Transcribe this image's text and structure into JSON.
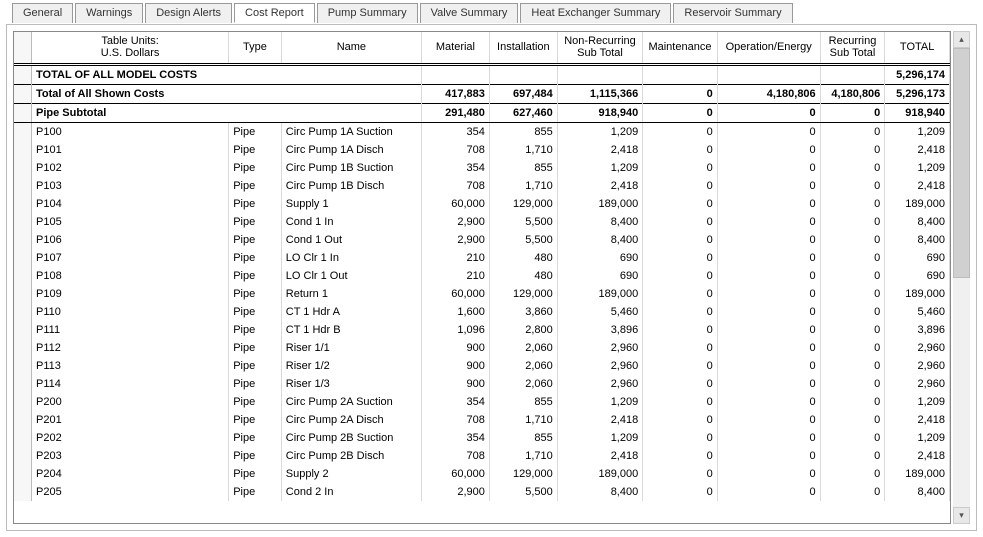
{
  "tabs": [
    {
      "label": "General"
    },
    {
      "label": "Warnings"
    },
    {
      "label": "Design Alerts"
    },
    {
      "label": "Cost Report",
      "active": true
    },
    {
      "label": "Pump Summary"
    },
    {
      "label": "Valve Summary"
    },
    {
      "label": "Heat Exchanger Summary"
    },
    {
      "label": "Reservoir Summary"
    }
  ],
  "headers": {
    "units": "Table Units:\nU.S. Dollars",
    "type": "Type",
    "name": "Name",
    "material": "Material",
    "installation": "Installation",
    "nr_subtotal": "Non-Recurring\nSub Total",
    "maintenance": "Maintenance",
    "op_energy": "Operation/Energy",
    "r_subtotal": "Recurring\nSub Total",
    "total": "TOTAL"
  },
  "summary": {
    "model_total": {
      "label": "TOTAL OF ALL MODEL COSTS",
      "total": "5,296,174"
    },
    "shown_total": {
      "label": "Total of All Shown Costs",
      "material": "417,883",
      "installation": "697,484",
      "nrst": "1,115,366",
      "maint": "0",
      "open": "4,180,806",
      "rst": "4,180,806",
      "total": "5,296,173"
    },
    "pipe_subtotal": {
      "label": "Pipe Subtotal",
      "material": "291,480",
      "installation": "627,460",
      "nrst": "918,940",
      "maint": "0",
      "open": "0",
      "rst": "0",
      "total": "918,940"
    }
  },
  "rows": [
    {
      "id": "P100",
      "type": "Pipe",
      "name": "Circ Pump 1A Suction",
      "m": "354",
      "i": "855",
      "nr": "1,209",
      "mt": "0",
      "oe": "0",
      "rs": "0",
      "t": "1,209"
    },
    {
      "id": "P101",
      "type": "Pipe",
      "name": "Circ Pump 1A Disch",
      "m": "708",
      "i": "1,710",
      "nr": "2,418",
      "mt": "0",
      "oe": "0",
      "rs": "0",
      "t": "2,418"
    },
    {
      "id": "P102",
      "type": "Pipe",
      "name": "Circ Pump 1B Suction",
      "m": "354",
      "i": "855",
      "nr": "1,209",
      "mt": "0",
      "oe": "0",
      "rs": "0",
      "t": "1,209"
    },
    {
      "id": "P103",
      "type": "Pipe",
      "name": "Circ Pump 1B Disch",
      "m": "708",
      "i": "1,710",
      "nr": "2,418",
      "mt": "0",
      "oe": "0",
      "rs": "0",
      "t": "2,418"
    },
    {
      "id": "P104",
      "type": "Pipe",
      "name": "Supply 1",
      "m": "60,000",
      "i": "129,000",
      "nr": "189,000",
      "mt": "0",
      "oe": "0",
      "rs": "0",
      "t": "189,000"
    },
    {
      "id": "P105",
      "type": "Pipe",
      "name": "Cond 1 In",
      "m": "2,900",
      "i": "5,500",
      "nr": "8,400",
      "mt": "0",
      "oe": "0",
      "rs": "0",
      "t": "8,400"
    },
    {
      "id": "P106",
      "type": "Pipe",
      "name": "Cond 1 Out",
      "m": "2,900",
      "i": "5,500",
      "nr": "8,400",
      "mt": "0",
      "oe": "0",
      "rs": "0",
      "t": "8,400"
    },
    {
      "id": "P107",
      "type": "Pipe",
      "name": "LO Clr 1 In",
      "m": "210",
      "i": "480",
      "nr": "690",
      "mt": "0",
      "oe": "0",
      "rs": "0",
      "t": "690"
    },
    {
      "id": "P108",
      "type": "Pipe",
      "name": "LO Clr 1 Out",
      "m": "210",
      "i": "480",
      "nr": "690",
      "mt": "0",
      "oe": "0",
      "rs": "0",
      "t": "690"
    },
    {
      "id": "P109",
      "type": "Pipe",
      "name": "Return 1",
      "m": "60,000",
      "i": "129,000",
      "nr": "189,000",
      "mt": "0",
      "oe": "0",
      "rs": "0",
      "t": "189,000"
    },
    {
      "id": "P110",
      "type": "Pipe",
      "name": "CT 1 Hdr A",
      "m": "1,600",
      "i": "3,860",
      "nr": "5,460",
      "mt": "0",
      "oe": "0",
      "rs": "0",
      "t": "5,460"
    },
    {
      "id": "P111",
      "type": "Pipe",
      "name": "CT 1 Hdr B",
      "m": "1,096",
      "i": "2,800",
      "nr": "3,896",
      "mt": "0",
      "oe": "0",
      "rs": "0",
      "t": "3,896"
    },
    {
      "id": "P112",
      "type": "Pipe",
      "name": "Riser 1/1",
      "m": "900",
      "i": "2,060",
      "nr": "2,960",
      "mt": "0",
      "oe": "0",
      "rs": "0",
      "t": "2,960"
    },
    {
      "id": "P113",
      "type": "Pipe",
      "name": "Riser 1/2",
      "m": "900",
      "i": "2,060",
      "nr": "2,960",
      "mt": "0",
      "oe": "0",
      "rs": "0",
      "t": "2,960"
    },
    {
      "id": "P114",
      "type": "Pipe",
      "name": "Riser 1/3",
      "m": "900",
      "i": "2,060",
      "nr": "2,960",
      "mt": "0",
      "oe": "0",
      "rs": "0",
      "t": "2,960"
    },
    {
      "id": "P200",
      "type": "Pipe",
      "name": "Circ Pump 2A Suction",
      "m": "354",
      "i": "855",
      "nr": "1,209",
      "mt": "0",
      "oe": "0",
      "rs": "0",
      "t": "1,209"
    },
    {
      "id": "P201",
      "type": "Pipe",
      "name": "Circ Pump 2A Disch",
      "m": "708",
      "i": "1,710",
      "nr": "2,418",
      "mt": "0",
      "oe": "0",
      "rs": "0",
      "t": "2,418"
    },
    {
      "id": "P202",
      "type": "Pipe",
      "name": "Circ Pump 2B Suction",
      "m": "354",
      "i": "855",
      "nr": "1,209",
      "mt": "0",
      "oe": "0",
      "rs": "0",
      "t": "1,209"
    },
    {
      "id": "P203",
      "type": "Pipe",
      "name": "Circ Pump 2B Disch",
      "m": "708",
      "i": "1,710",
      "nr": "2,418",
      "mt": "0",
      "oe": "0",
      "rs": "0",
      "t": "2,418"
    },
    {
      "id": "P204",
      "type": "Pipe",
      "name": "Supply 2",
      "m": "60,000",
      "i": "129,000",
      "nr": "189,000",
      "mt": "0",
      "oe": "0",
      "rs": "0",
      "t": "189,000"
    },
    {
      "id": "P205",
      "type": "Pipe",
      "name": "Cond 2 In",
      "m": "2,900",
      "i": "5,500",
      "nr": "8,400",
      "mt": "0",
      "oe": "0",
      "rs": "0",
      "t": "8,400"
    }
  ]
}
